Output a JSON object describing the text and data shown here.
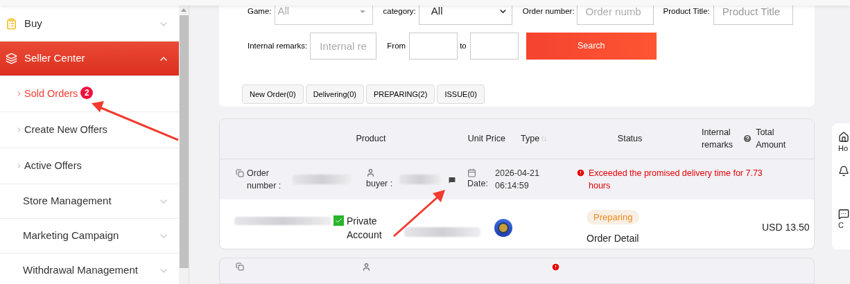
{
  "sidebar": {
    "items": [
      {
        "label": "Buy",
        "kind": "icon-section",
        "expanded": false,
        "selected": false
      },
      {
        "label": "Seller Center",
        "kind": "icon-section",
        "expanded": true,
        "selected": true,
        "children": [
          {
            "label": "Sold Orders",
            "selected": true,
            "badge": "2"
          },
          {
            "label": "Create New Offers",
            "selected": false
          },
          {
            "label": "Active Offers",
            "selected": false
          }
        ]
      },
      {
        "label": "Store Management",
        "kind": "plain",
        "expanded": false,
        "selected": false
      },
      {
        "label": "Marketing Campaign",
        "kind": "plain",
        "expanded": false,
        "selected": false
      },
      {
        "label": "Withdrawal Management",
        "kind": "plain",
        "expanded": false,
        "selected": false
      }
    ]
  },
  "filters": {
    "game": {
      "label": "Game:",
      "value": "All"
    },
    "category": {
      "label": "category:",
      "value": "All"
    },
    "order_number": {
      "label": "Order number:",
      "placeholder": "Order numb"
    },
    "product_title": {
      "label": "Product Title:",
      "placeholder": "Product Title"
    },
    "internal_remarks": {
      "label": "Internal remarks:",
      "placeholder": "Internal re"
    },
    "from": {
      "label": "From"
    },
    "to": {
      "label": "to"
    },
    "search_button": "Search"
  },
  "status_tabs": [
    {
      "label": "New Order(0)",
      "selected": false
    },
    {
      "label": "Delivering(0)",
      "selected": false
    },
    {
      "label": "PREPARING(2)",
      "selected": false
    },
    {
      "label": "ISSUE(0)",
      "selected": false
    }
  ],
  "table": {
    "columns": [
      "Product",
      "Unit Price",
      "Type",
      "Status",
      "Internal remarks",
      "Total Amount"
    ],
    "orders": [
      {
        "order_number_label": "Order number :",
        "buyer_label": "buyer :",
        "date_label": "Date:",
        "date": "2026-04-21 06:14:59",
        "warning": "Exceeded the promised delivery time for 7.73 hours",
        "product_title": "Private Account",
        "private_checked": true,
        "status": "Preparing",
        "detail_link": "Order Detail",
        "total": "USD 13.50"
      }
    ]
  },
  "side_panel": {
    "items": [
      {
        "kind": "home",
        "label": "Ho"
      },
      {
        "kind": "bell"
      },
      {
        "kind": "chat",
        "label": "C"
      }
    ]
  }
}
